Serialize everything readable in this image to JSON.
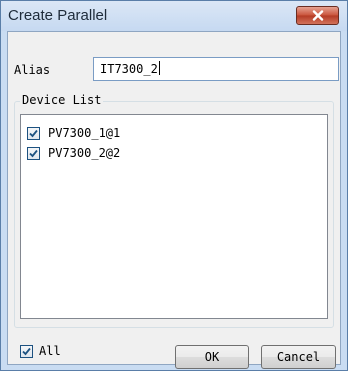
{
  "window": {
    "title": "Create Parallel"
  },
  "alias": {
    "label": "Alias",
    "value": "IT7300_2"
  },
  "device_list": {
    "title": "Device List",
    "items": [
      {
        "label": "PV7300_1@1",
        "checked": true
      },
      {
        "label": "PV7300_2@2",
        "checked": true
      }
    ]
  },
  "footer": {
    "all_label": "All",
    "all_checked": true,
    "ok_label": "OK",
    "cancel_label": "Cancel"
  },
  "colors": {
    "title_bar": "#c6d9f1",
    "close_button": "#c9523a",
    "check_mark": "#1c5180"
  }
}
